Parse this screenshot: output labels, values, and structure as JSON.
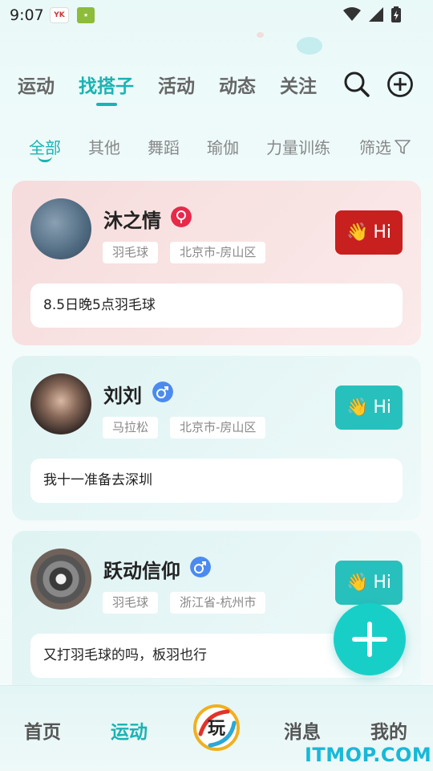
{
  "status_bar": {
    "time": "9:07",
    "app1": "YK",
    "app2": "app"
  },
  "top_tabs": [
    {
      "label": "运动",
      "active": false
    },
    {
      "label": "找搭子",
      "active": true
    },
    {
      "label": "活动",
      "active": false
    },
    {
      "label": "动态",
      "active": false
    },
    {
      "label": "关注",
      "active": false
    }
  ],
  "sub_tabs": [
    {
      "label": "全部",
      "active": true
    },
    {
      "label": "其他",
      "active": false
    },
    {
      "label": "舞蹈",
      "active": false
    },
    {
      "label": "瑜伽",
      "active": false
    },
    {
      "label": "力量训练",
      "active": false
    }
  ],
  "filter_label": "筛选",
  "cards": [
    {
      "name": "沐之情",
      "gender": "female",
      "tags": [
        "羽毛球",
        "北京市-房山区"
      ],
      "hi_label": "Hi",
      "message": "8.5日晚5点羽毛球",
      "theme": "pink"
    },
    {
      "name": "刘刘",
      "gender": "male",
      "tags": [
        "马拉松",
        "北京市-房山区"
      ],
      "hi_label": "Hi",
      "message": "我十一准备去深圳",
      "theme": "teal"
    },
    {
      "name": "跃动信仰",
      "gender": "male",
      "tags": [
        "羽毛球",
        "浙江省-杭州市"
      ],
      "hi_label": "Hi",
      "message": "又打羽毛球的吗，板羽也行",
      "theme": "teal"
    }
  ],
  "bottom_nav": {
    "home": "首页",
    "sport": "运动",
    "messages": "消息",
    "mine": "我的",
    "watermark": "ITMOP.COM"
  },
  "colors": {
    "accent": "#1bb3b3",
    "hi_red": "#c81f1f",
    "hi_teal": "#28c0bc",
    "female": "#e8294a",
    "male": "#4b8bef"
  }
}
